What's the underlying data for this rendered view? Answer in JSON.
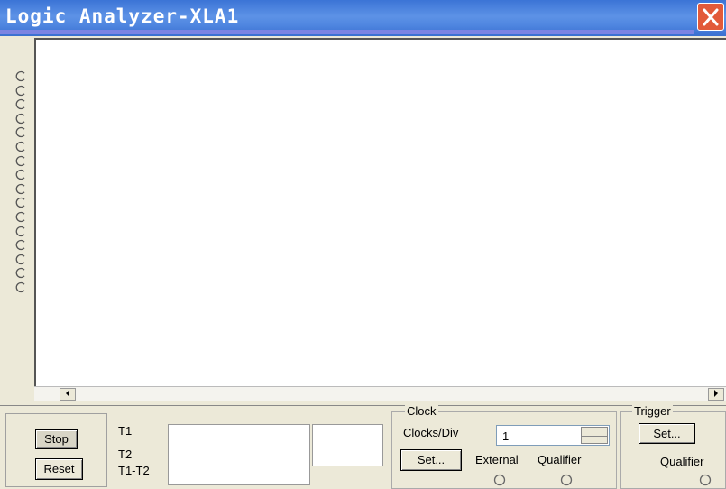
{
  "window": {
    "title": "Logic Analyzer-XLA1"
  },
  "channels": {
    "count": 16
  },
  "controls": {
    "stop_label": "Stop",
    "reset_label": "Reset"
  },
  "cursors": {
    "t1": "T1",
    "t2": "T2",
    "t1t2": "T1-T2"
  },
  "clock": {
    "group_label": "Clock",
    "clocks_div_label": "Clocks/Div",
    "clocks_div_value": "1",
    "set_label": "Set...",
    "external_label": "External",
    "qualifier_label": "Qualifier"
  },
  "trigger": {
    "group_label": "Trigger",
    "set_label": "Set...",
    "qualifier_label": "Qualifier"
  },
  "icons": {
    "close": "close-icon",
    "channel_terminal": "radio-terminal-icon",
    "scroll_left": "arrow-left-icon",
    "scroll_right": "arrow-right-icon"
  },
  "colors": {
    "titlebar": "#4f86e0",
    "close": "#e25a3a",
    "display": "#ffffff",
    "face": "#ece9d8"
  }
}
